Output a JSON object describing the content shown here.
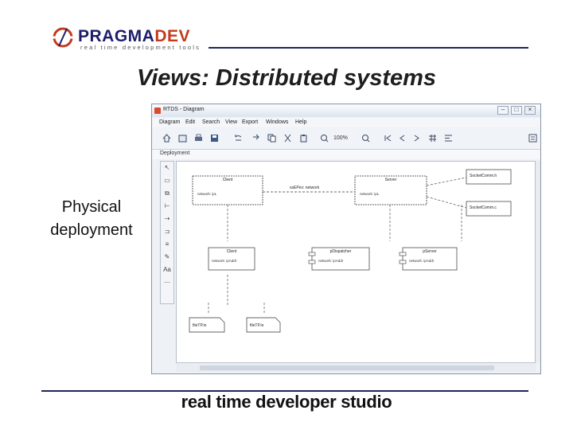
{
  "header": {
    "logo_word_1": "PRAGMA",
    "logo_word_2": "DEV",
    "logo_tagline": "real time development tools",
    "title": "Views: Distributed systems"
  },
  "caption": {
    "line1": "Physical",
    "line2": "deployment"
  },
  "footer": {
    "text": "real time developer studio"
  },
  "window": {
    "title": "RTDS - Diagram",
    "menu": [
      "Diagram",
      "Edit",
      "Search",
      "View",
      "Export",
      "Windows",
      "Help"
    ],
    "zoom": "100%",
    "tab_label": "Deployment",
    "controls": {
      "minimize": "–",
      "maximize": "□",
      "close": "×"
    }
  },
  "diagram": {
    "nodes": {
      "client_node": {
        "name": "Client",
        "detail": "network: ipL"
      },
      "server_node": {
        "name": "Server",
        "detail": "network: ipL"
      },
      "network_label": "ssEPex: network",
      "socket_h": "SocketComm.h",
      "socket_c": "SocketComm.c",
      "comp_client": {
        "name": "Client",
        "detail": "network: ipAddr"
      },
      "comp_dispatcher": {
        "name": "pDispatcher",
        "detail": "network: ipAddr"
      },
      "comp_server": {
        "name": "pServer",
        "detail": "network: ipAddr"
      },
      "file_1": "fileTP.in",
      "file_2": "fileTP.in"
    }
  },
  "colors": {
    "title_navy": "#1c2560",
    "logo_red": "#c33a1d",
    "logo_navy": "#1d1d6b"
  }
}
